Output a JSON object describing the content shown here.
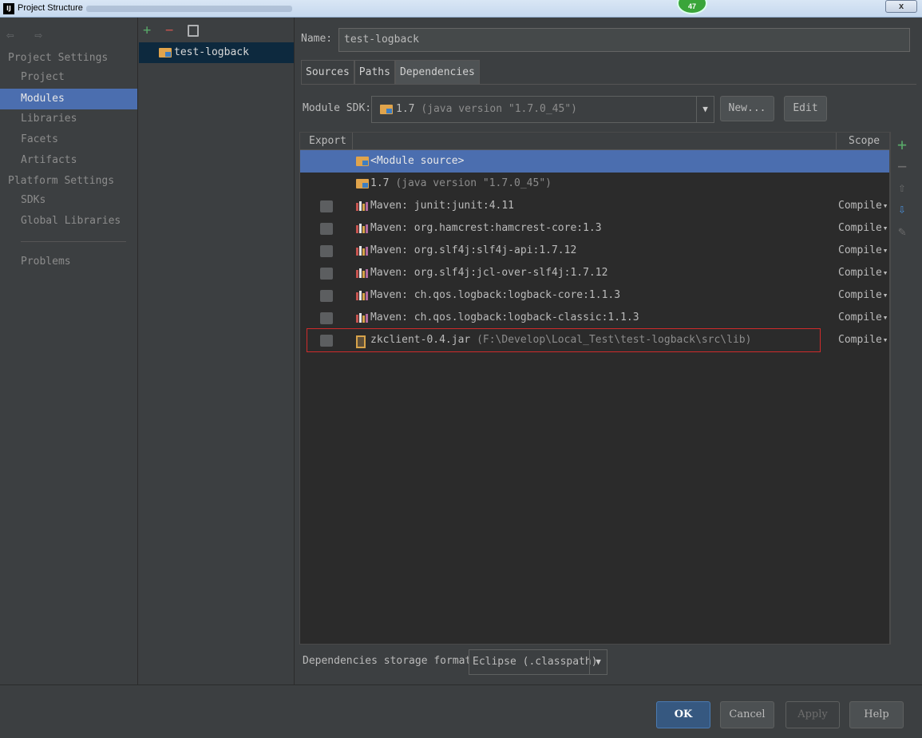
{
  "window": {
    "title": "Project Structure",
    "app_icon": "IJ",
    "badge": "47",
    "close": "x"
  },
  "nav": {
    "back_forward": "⇦ ⇨",
    "sections": [
      {
        "label": "Project Settings"
      },
      {
        "label": "Platform Settings"
      }
    ],
    "items": [
      {
        "label": "Project"
      },
      {
        "label": "Modules"
      },
      {
        "label": "Libraries"
      },
      {
        "label": "Facets"
      },
      {
        "label": "Artifacts"
      },
      {
        "label": "SDKs"
      },
      {
        "label": "Global Libraries"
      },
      {
        "label": "Problems"
      }
    ],
    "selected": "Modules"
  },
  "modules": {
    "toolbar": {
      "add": "+",
      "remove": "−"
    },
    "list": [
      {
        "name": "test-logback"
      }
    ]
  },
  "module": {
    "name_label": "Name:",
    "name_value": "test-logback",
    "tabs": [
      {
        "label": "Sources"
      },
      {
        "label": "Paths"
      },
      {
        "label": "Dependencies"
      }
    ],
    "active_tab": "Dependencies",
    "sdk_label": "Module SDK:",
    "sdk_value": "1.7",
    "sdk_detail": "(java version \"1.7.0_45\")",
    "new_button": "New...",
    "edit_button": "Edit"
  },
  "dependencies": {
    "columns": {
      "export": "Export",
      "scope": "Scope"
    },
    "rows": [
      {
        "name": "<Module source>",
        "detail": "",
        "scope": "",
        "checkbox": false,
        "icon": "folder-icon"
      },
      {
        "name": "1.7",
        "detail": "(java version \"1.7.0_45\")",
        "scope": "",
        "checkbox": false,
        "icon": "folder-icon"
      },
      {
        "name": "Maven: junit:junit:4.11",
        "detail": "",
        "scope": "Compile",
        "checkbox": true,
        "icon": "maven-library-icon"
      },
      {
        "name": "Maven: org.hamcrest:hamcrest-core:1.3",
        "detail": "",
        "scope": "Compile",
        "checkbox": true,
        "icon": "maven-library-icon"
      },
      {
        "name": "Maven: org.slf4j:slf4j-api:1.7.12",
        "detail": "",
        "scope": "Compile",
        "checkbox": true,
        "icon": "maven-library-icon"
      },
      {
        "name": "Maven: org.slf4j:jcl-over-slf4j:1.7.12",
        "detail": "",
        "scope": "Compile",
        "checkbox": true,
        "icon": "maven-library-icon"
      },
      {
        "name": "Maven: ch.qos.logback:logback-core:1.1.3",
        "detail": "",
        "scope": "Compile",
        "checkbox": true,
        "icon": "maven-library-icon"
      },
      {
        "name": "Maven: ch.qos.logback:logback-classic:1.1.3",
        "detail": "",
        "scope": "Compile",
        "checkbox": true,
        "icon": "maven-library-icon"
      },
      {
        "name": "zkclient-0.4.jar",
        "detail": "(F:\\Develop\\Local_Test\\test-logback\\src\\lib)",
        "scope": "Compile",
        "checkbox": true,
        "icon": "jar-icon"
      }
    ],
    "side_toolbar": {
      "add": "+",
      "remove": "−",
      "up": "⇧",
      "down": "⇩",
      "edit": "✎"
    },
    "storage_label": "Dependencies storage format:",
    "storage_value": "Eclipse (.classpath)"
  },
  "footer": {
    "ok": "OK",
    "cancel": "Cancel",
    "apply": "Apply",
    "help": "Help"
  },
  "colors": {
    "selection": "#4b6eaf",
    "background": "#3c3f41",
    "table_background": "#2b2b2b",
    "highlight_border": "#d02b2b",
    "add_green": "#59a869",
    "remove_red": "#c75450"
  }
}
